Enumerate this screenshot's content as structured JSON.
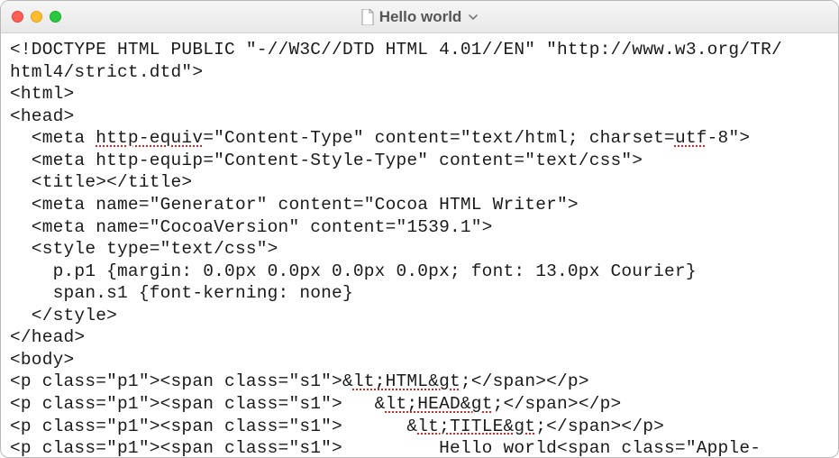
{
  "titlebar": {
    "doc_icon": "document-icon",
    "title": "Hello world",
    "dropdown_icon": "chevron-down"
  },
  "traffic_lights": {
    "close": "close",
    "minimize": "minimize",
    "zoom": "zoom"
  },
  "editor": {
    "lines": [
      {
        "segments": [
          {
            "t": "<!DOCTYPE HTML PUBLIC \"-//W3C//DTD HTML 4.01//EN\" \"http://www.w3.org/TR/"
          }
        ]
      },
      {
        "segments": [
          {
            "t": "html4/strict.dtd\">"
          }
        ]
      },
      {
        "segments": [
          {
            "t": "<html>"
          }
        ]
      },
      {
        "segments": [
          {
            "t": "<head>"
          }
        ]
      },
      {
        "segments": [
          {
            "t": "  <meta "
          },
          {
            "t": "http-equiv",
            "err": true
          },
          {
            "t": "=\"Content-Type\" content=\"text/html; charset="
          },
          {
            "t": "utf",
            "err": true
          },
          {
            "t": "-8\">"
          }
        ]
      },
      {
        "segments": [
          {
            "t": "  <meta http-equip=\"Content-Style-Type\" content=\"text/css\">"
          }
        ]
      },
      {
        "segments": [
          {
            "t": "  <title></title>"
          }
        ]
      },
      {
        "segments": [
          {
            "t": "  <meta name=\"Generator\" content=\"Cocoa HTML Writer\">"
          }
        ]
      },
      {
        "segments": [
          {
            "t": "  <meta name=\"CocoaVersion\" content=\"1539.1\">"
          }
        ]
      },
      {
        "segments": [
          {
            "t": "  <style type=\"text/css\">"
          }
        ]
      },
      {
        "segments": [
          {
            "t": "    p.p1 {margin: 0.0px 0.0px 0.0px 0.0px; font: 13.0px Courier}"
          }
        ]
      },
      {
        "segments": [
          {
            "t": "    span.s1 {font-kerning: none}"
          }
        ]
      },
      {
        "segments": [
          {
            "t": "  </style>"
          }
        ]
      },
      {
        "segments": [
          {
            "t": "</head>"
          }
        ]
      },
      {
        "segments": [
          {
            "t": "<body>"
          }
        ]
      },
      {
        "segments": [
          {
            "t": "<p class=\"p1\"><span class=\"s1\">&"
          },
          {
            "t": "lt;HTML&gt",
            "err": true
          },
          {
            "t": ";</span></p>"
          }
        ]
      },
      {
        "segments": [
          {
            "t": "<p class=\"p1\"><span class=\"s1\">   &"
          },
          {
            "t": "lt;HEAD&gt",
            "err": true
          },
          {
            "t": ";</span></p>"
          }
        ]
      },
      {
        "segments": [
          {
            "t": "<p class=\"p1\"><span class=\"s1\">      &"
          },
          {
            "t": "lt;TITLE&gt",
            "err": true
          },
          {
            "t": ";</span></p>"
          }
        ]
      },
      {
        "segments": [
          {
            "t": "<p class=\"p1\"><span class=\"s1\">         Hello world<span class=\"Apple-"
          }
        ]
      }
    ]
  }
}
